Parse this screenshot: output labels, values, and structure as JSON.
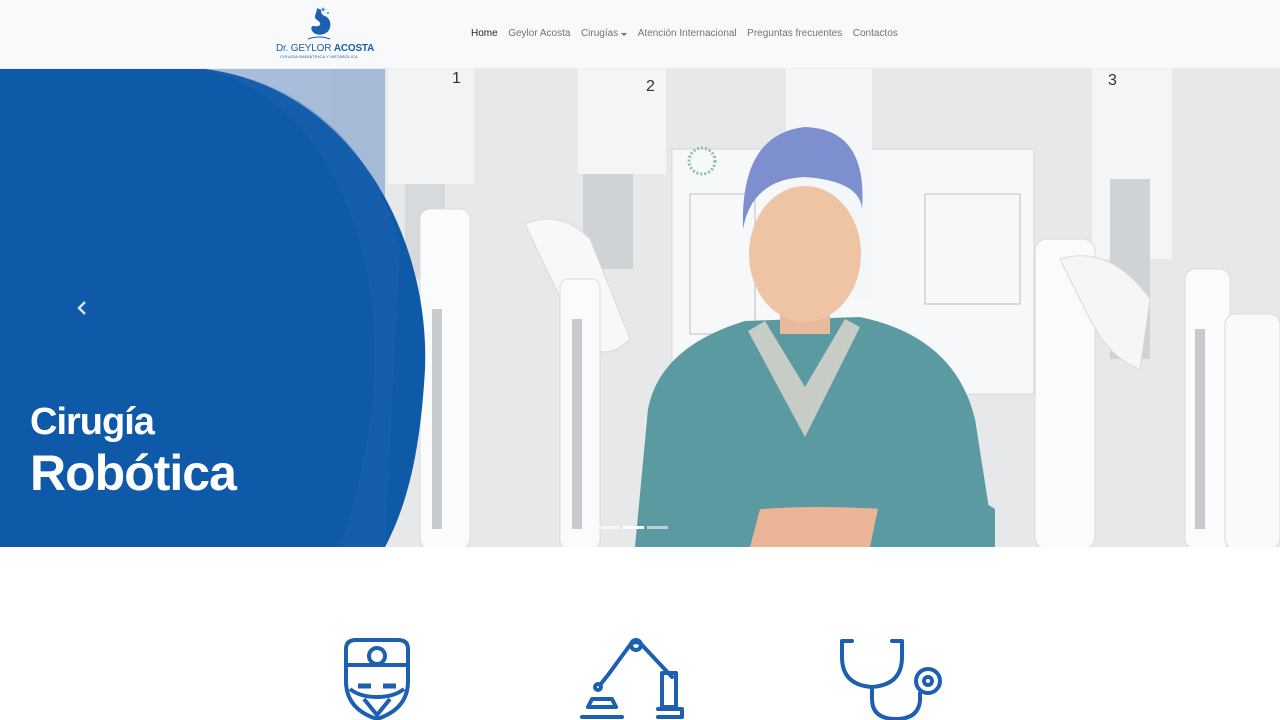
{
  "brand": {
    "name_prefix": "Dr. GEYLOR",
    "name_bold": "ACOSTA",
    "tagline": "CIRUGÍA BARIÁTRICA Y METABÓLICA",
    "color": "#1d5fb0"
  },
  "nav": {
    "items": [
      {
        "label": "Home",
        "active": true
      },
      {
        "label": "Geylor Acosta"
      },
      {
        "label": "Cirugías",
        "dropdown": true
      },
      {
        "label": "Atención Internacional"
      },
      {
        "label": "Preguntas frecuentes"
      },
      {
        "label": "Contactos"
      }
    ]
  },
  "hero": {
    "title_line1": "Cirugía",
    "title_line2": "Robótica",
    "overlay_color": "#0f5aa8",
    "active_slide": 2,
    "slide_count": 3,
    "arm_numbers": [
      "1",
      "2",
      "3"
    ],
    "prev_icon": "chevron-left-icon"
  },
  "features": {
    "icons": [
      "surgeon-icon",
      "robotic-arm-icon",
      "stethoscope-icon"
    ],
    "icon_color": "#1d5fb0"
  }
}
